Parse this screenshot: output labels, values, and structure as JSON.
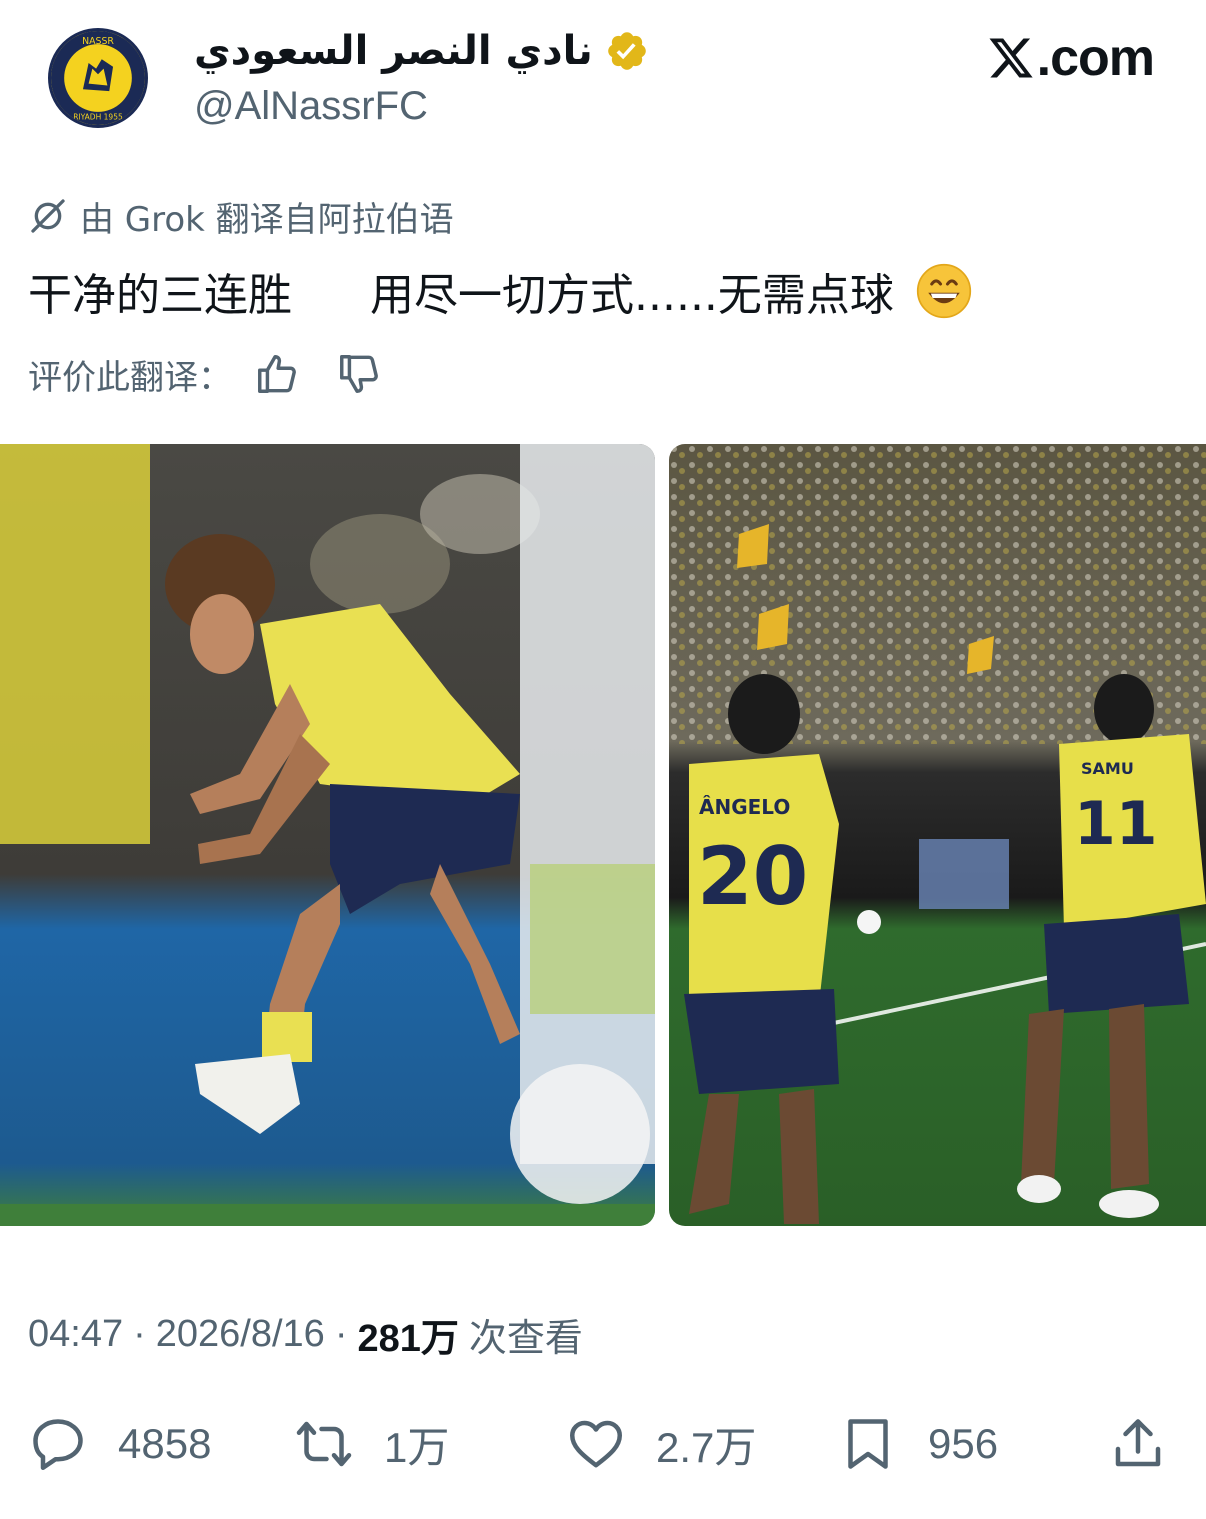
{
  "header": {
    "display_name": "نادي النصر السعودي",
    "handle": "@AlNassrFC",
    "brand": ".com",
    "verified_color": "#e2b719",
    "avatar_icon": "al-nassr-club-crest"
  },
  "translation": {
    "note": "由 Grok 翻译自阿拉伯语",
    "text_part1": "干净的三连胜",
    "text_part2": "用尽一切方式......无需点球",
    "emoji": "grinning-face-emoji",
    "rate_label": "评价此翻译："
  },
  "media": [
    {
      "icon": "photo-player-kicking-ball"
    },
    {
      "icon": "photo-players-celebrating"
    }
  ],
  "meta": {
    "time": "04:47",
    "date": "2026/8/16",
    "separator": "·",
    "views_count": "281万",
    "views_label": "次查看"
  },
  "actions": {
    "replies": "4858",
    "reposts": "1万",
    "likes": "2.7万",
    "bookmarks": "956"
  },
  "colors": {
    "text_primary": "#0f1419",
    "text_secondary": "#536471",
    "club_yellow": "#f4d21f",
    "club_navy": "#1b2a55"
  }
}
